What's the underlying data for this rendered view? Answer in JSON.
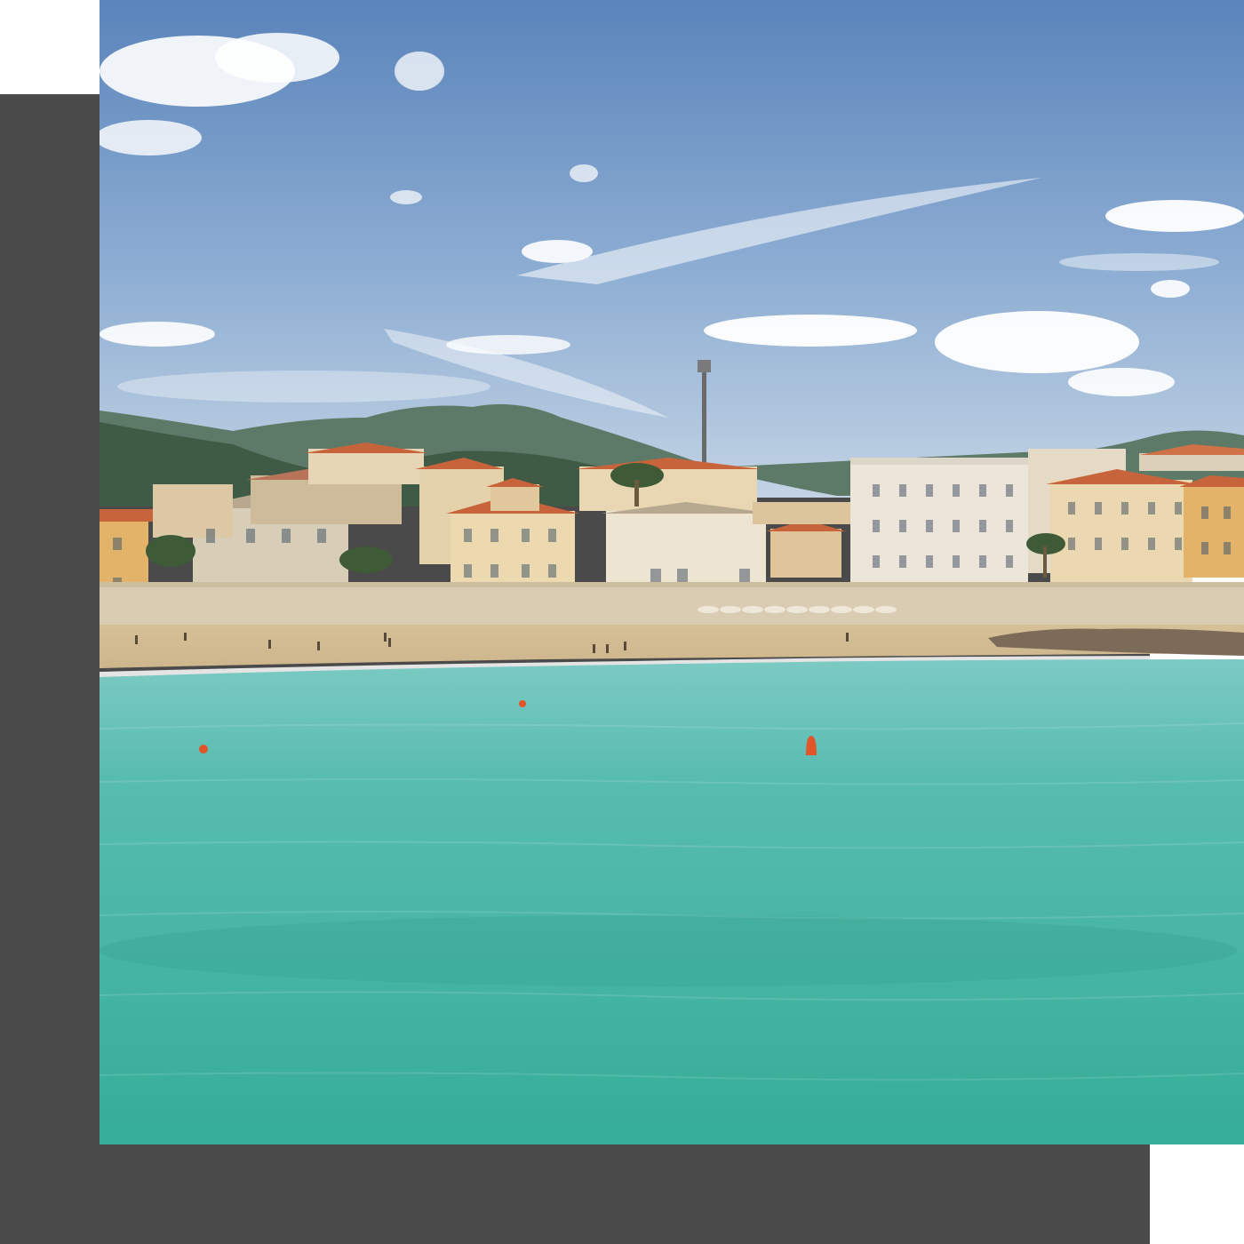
{
  "image": {
    "subject": "coastal-town-beach-scene",
    "colors": {
      "backdrop": "#4a4a4a",
      "page_background": "#ffffff",
      "sky_top": "#5b86bd",
      "sky_bottom": "#b8cbe0",
      "hill": "#3f5a45",
      "hill_far": "#5d7a68",
      "building_cream": "#e9d9b4",
      "building_ochre": "#e3b36a",
      "building_white": "#ece6da",
      "roof": "#c8643c",
      "sand": "#d9c39c",
      "sea_near": "#3fb3a0",
      "sea_far": "#6ec6c0",
      "buoy": "#e0552a",
      "cloud": "#ffffff"
    }
  }
}
